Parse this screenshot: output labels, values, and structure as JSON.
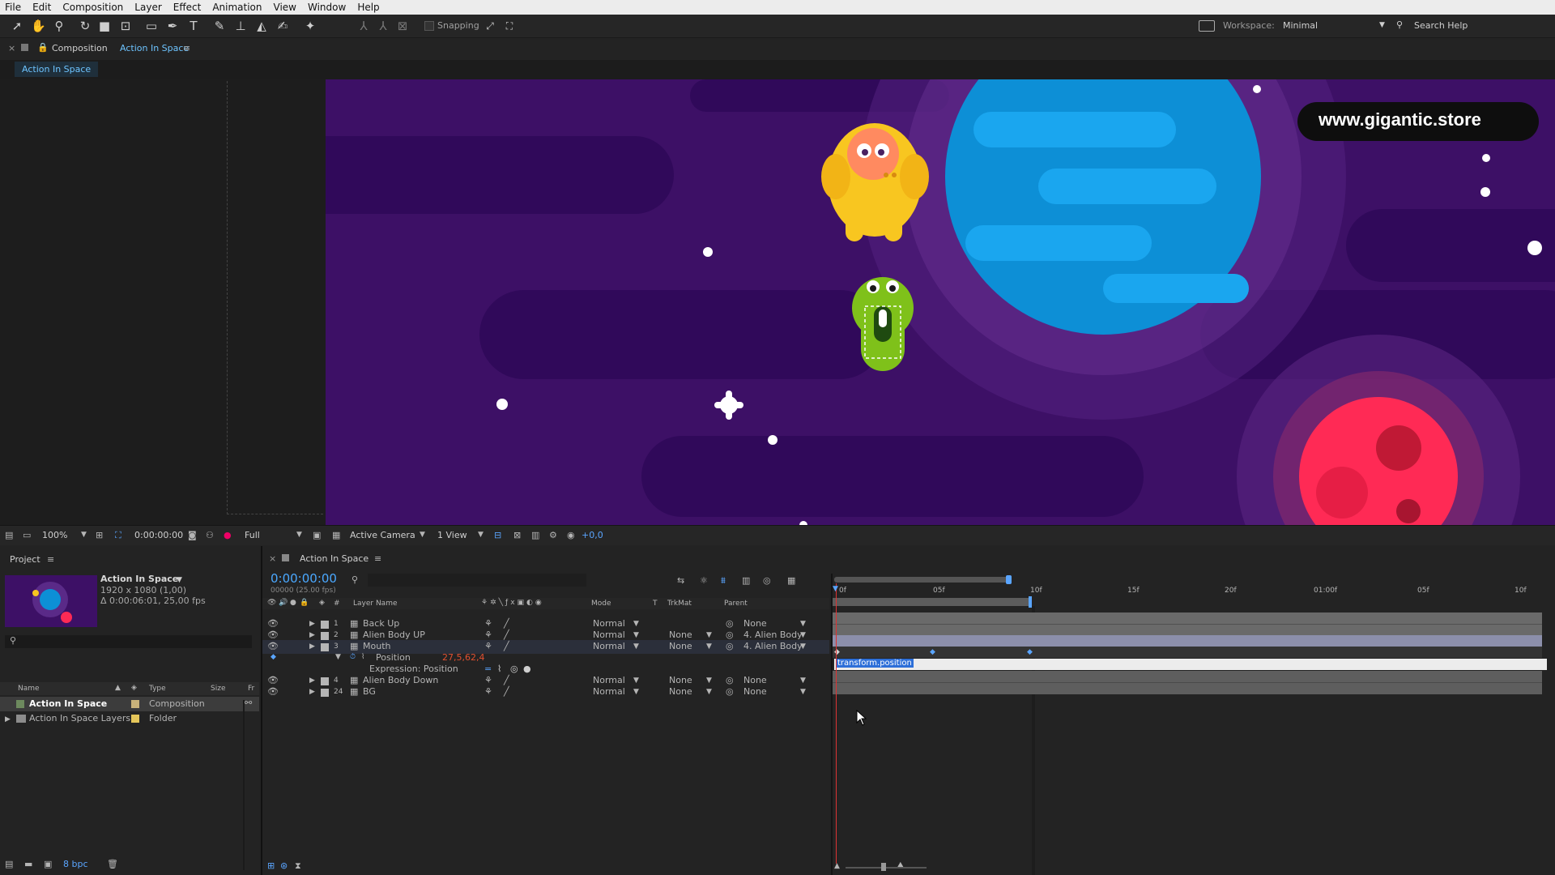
{
  "menu": [
    "File",
    "Edit",
    "Composition",
    "Layer",
    "Effect",
    "Animation",
    "View",
    "Window",
    "Help"
  ],
  "toolbar": {
    "snapping_label": "Snapping",
    "workspace_label": "Workspace:",
    "workspace_value": "Minimal",
    "search_help": "Search Help"
  },
  "comp_panel": {
    "title_prefix": "Composition",
    "title_name": "Action In Space",
    "tab": "Action In Space"
  },
  "viewer": {
    "watermark": "www.gigantic.store",
    "zoom": "100%",
    "timecode": "0:00:00:00",
    "resolution": "Full",
    "camera": "Active Camera",
    "views": "1 View",
    "exposure": "+0,0"
  },
  "project": {
    "title": "Project",
    "comp_name": "Action In Space",
    "comp_size": "1920 x 1080 (1,00)",
    "comp_duration": "Δ 0:00:06:01, 25,00 fps",
    "columns": [
      "Name",
      "Type",
      "Size",
      "Fr"
    ],
    "items": [
      {
        "name": "Action In Space",
        "type": "Composition",
        "color": "#c8b27a"
      },
      {
        "name": "Action In Space Layers",
        "type": "Folder",
        "color": "#e5c65a"
      }
    ],
    "bpc": "8 bpc"
  },
  "timeline": {
    "tab": "Action In Space",
    "timecode": "0:00:00:00",
    "frames": "00000 (25.00 fps)",
    "columns": {
      "num": "#",
      "name": "Layer Name",
      "mode": "Mode",
      "t": "T",
      "trkmat": "TrkMat",
      "parent": "Parent"
    },
    "ruler": [
      "0f",
      "05f",
      "10f",
      "15f",
      "20f",
      "01:00f",
      "05f",
      "10f"
    ],
    "layers": [
      {
        "num": "1",
        "name": "Back Up",
        "mode": "Normal",
        "trkmat": "",
        "parent": "None"
      },
      {
        "num": "2",
        "name": "Alien Body UP",
        "mode": "Normal",
        "trkmat": "None",
        "parent": "4. Alien Body"
      },
      {
        "num": "3",
        "name": "Mouth",
        "mode": "Normal",
        "trkmat": "None",
        "parent": "4. Alien Body"
      },
      {
        "num": "4",
        "name": "Alien Body Down",
        "mode": "Normal",
        "trkmat": "None",
        "parent": "None"
      },
      {
        "num": "24",
        "name": "BG",
        "mode": "Normal",
        "trkmat": "None",
        "parent": "None"
      }
    ],
    "position_prop": "Position",
    "position_value": "27,5,62,4",
    "expression_label": "Expression: Position",
    "expression_text": "transform.position"
  },
  "colors": {
    "accent": "#2d8ceb",
    "timecode": "#4aa8ff",
    "red_value": "#e0502f",
    "scene_bg": "#3d1066",
    "planet_blue": "#0d8fd6",
    "planet_red": "#ff2a55"
  }
}
